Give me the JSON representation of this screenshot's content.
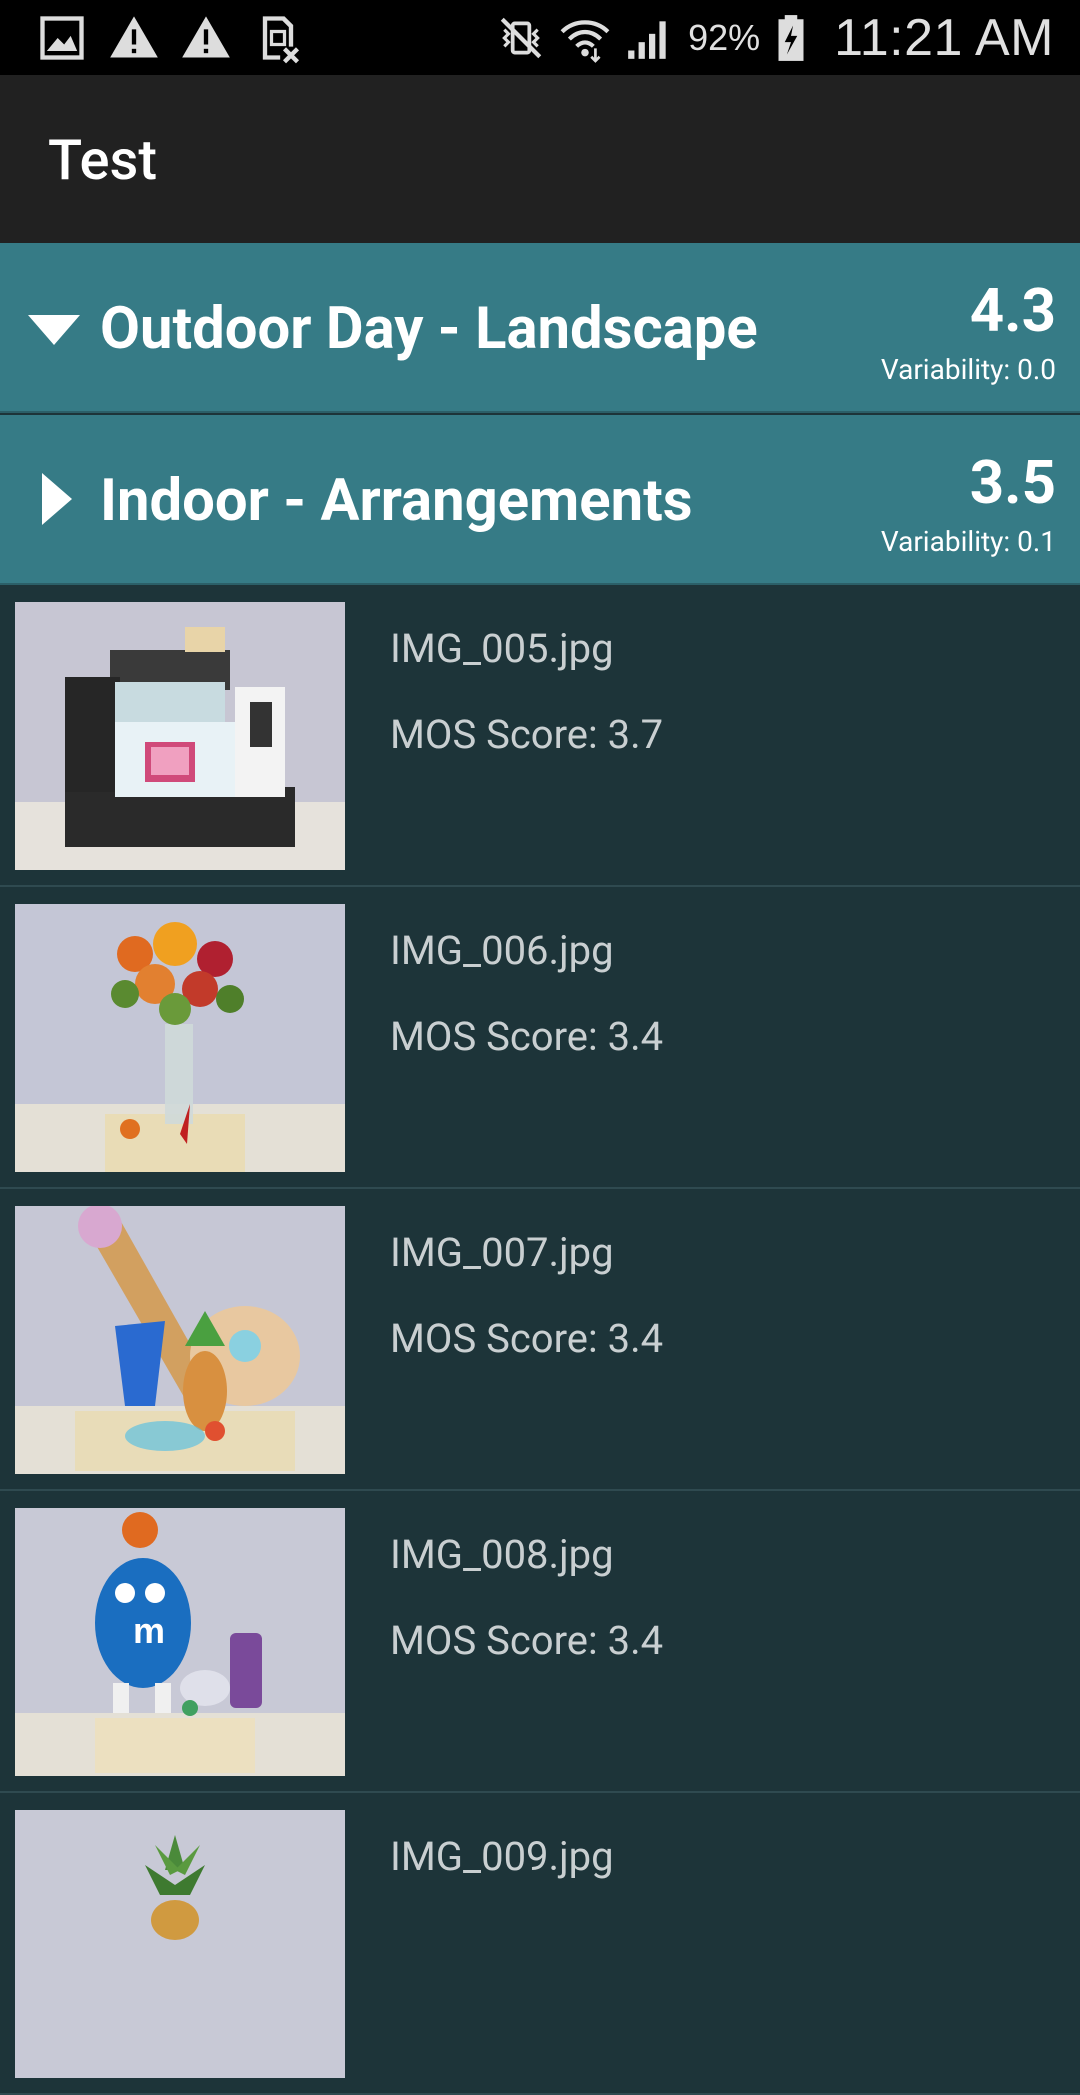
{
  "status_bar": {
    "battery_percent": "92%",
    "time": "11:21 AM",
    "icons": [
      "gallery-icon",
      "warning-icon",
      "warning-icon",
      "sim-off-icon",
      "vibrate-icon",
      "wifi-icon",
      "signal-icon",
      "battery-charging-icon"
    ]
  },
  "app_bar": {
    "title": "Test"
  },
  "groups": [
    {
      "title": "Outdoor Day - Landscape",
      "score": "4.3",
      "variability": "Variability: 0.0",
      "expanded": true
    },
    {
      "title": "Indoor - Arrangements",
      "score": "3.5",
      "variability": "Variability: 0.1",
      "expanded": false
    }
  ],
  "items": [
    {
      "name": "IMG_005.jpg",
      "score": "MOS Score: 3.7"
    },
    {
      "name": "IMG_006.jpg",
      "score": "MOS Score: 3.4"
    },
    {
      "name": "IMG_007.jpg",
      "score": "MOS Score: 3.4"
    },
    {
      "name": "IMG_008.jpg",
      "score": "MOS Score: 3.4"
    },
    {
      "name": "IMG_009.jpg",
      "score": ""
    }
  ],
  "colors": {
    "group_header_bg": "#367b86",
    "list_bg": "#1d3439",
    "app_bar_bg": "#212121",
    "status_bar_bg": "#000000"
  }
}
